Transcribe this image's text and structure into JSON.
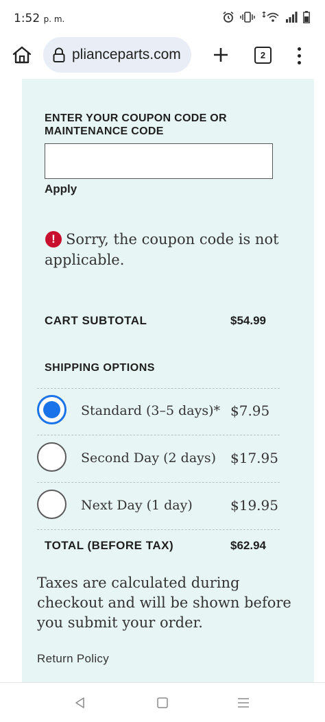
{
  "status_bar": {
    "time": "1:52",
    "ampm": "p. m."
  },
  "browser": {
    "url": "plianceparts.com",
    "tab_count": "2",
    "icons": [
      "home-icon",
      "lock-icon",
      "plus-icon",
      "tabs-icon",
      "more-vert-icon"
    ]
  },
  "coupon": {
    "heading": "ENTER YOUR COUPON CODE OR MAINTENANCE CODE",
    "input_value": "",
    "apply_label": "Apply",
    "error_icon": "!",
    "error_message": "Sorry, the coupon code is not applicable."
  },
  "cart": {
    "subtotal_label": "CART SUBTOTAL",
    "subtotal_value": "$54.99"
  },
  "shipping": {
    "heading": "SHIPPING OPTIONS",
    "selected_index": 0,
    "options": [
      {
        "label": "Standard (3–5 days)*",
        "price": "$7.95"
      },
      {
        "label": "Second Day (2 days)",
        "price": "$17.95"
      },
      {
        "label": "Next Day (1 day)",
        "price": "$19.95"
      }
    ]
  },
  "total": {
    "label": "TOTAL (BEFORE TAX)",
    "value": "$62.94"
  },
  "tax_note": "Taxes are calculated during checkout and will be shown before you submit your order.",
  "return_policy": "Return Policy",
  "colors": {
    "panel_bg": "#e8f5f5",
    "selected_radio": "#1a73e8",
    "error_red": "#c8102e"
  }
}
